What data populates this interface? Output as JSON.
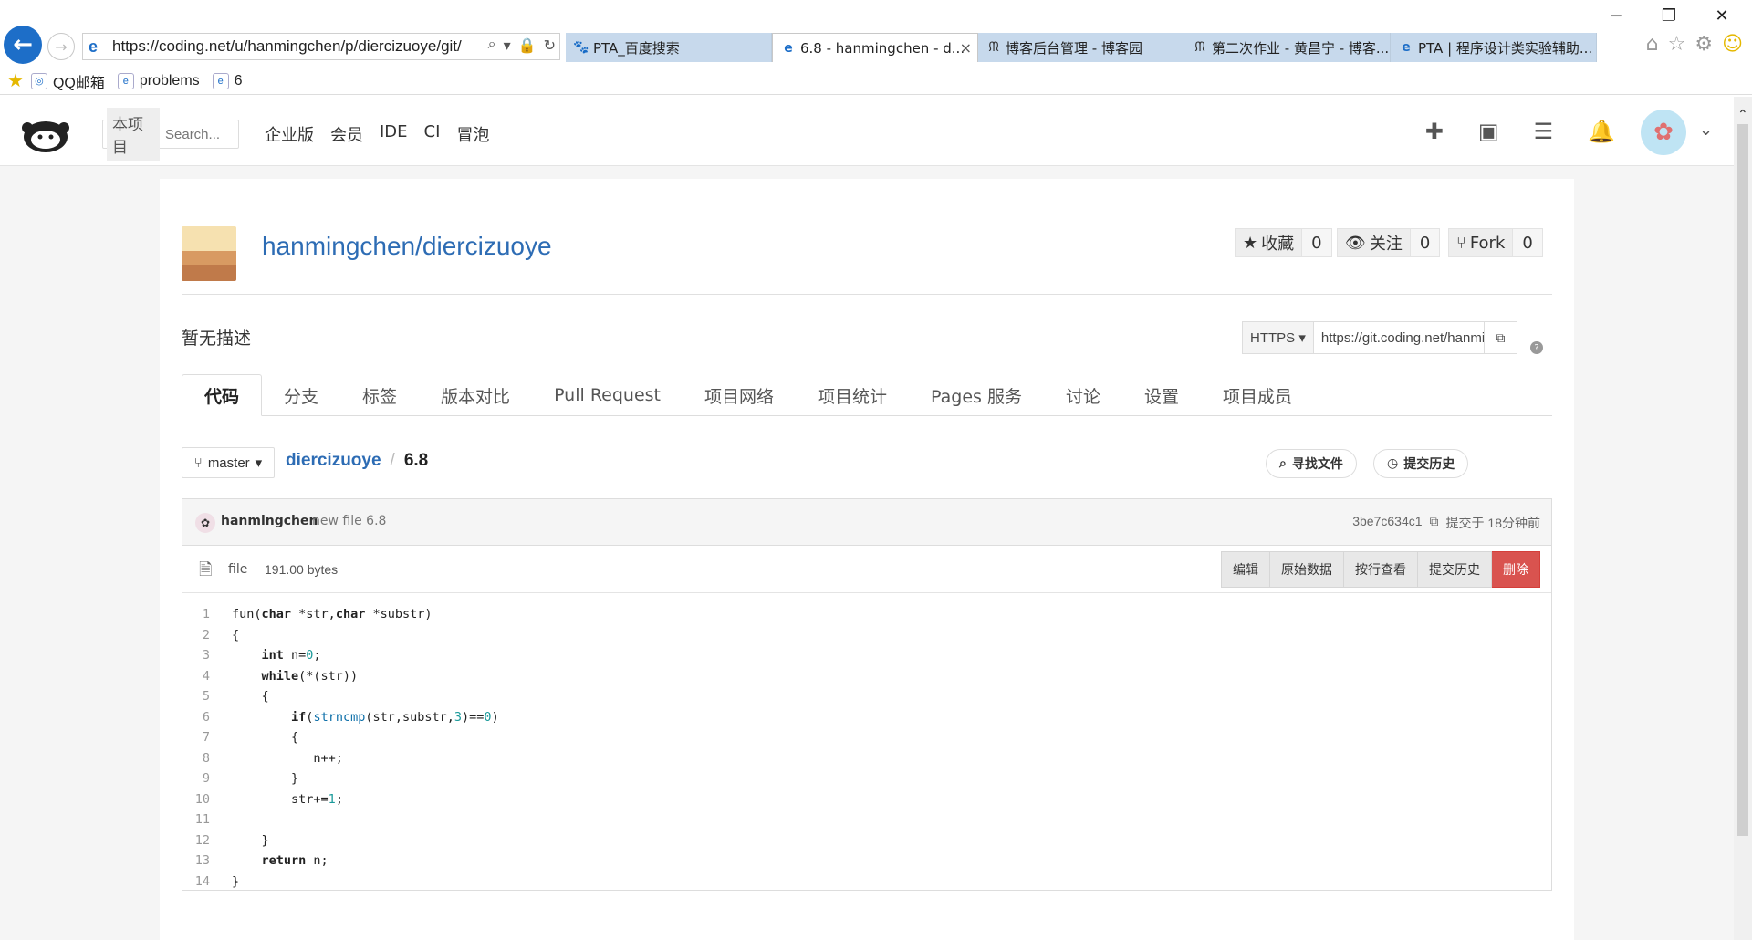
{
  "browser": {
    "address": "https://coding.net/u/hanmingchen/p/diercizuoye/git/",
    "tabs": [
      {
        "label": "PTA_百度搜索"
      },
      {
        "label": "6.8 - hanmingchen - d..."
      },
      {
        "label": "博客后台管理 - 博客园"
      },
      {
        "label": "第二次作业 - 黄昌宁 - 博客..."
      },
      {
        "label": "PTA | 程序设计类实验辅助..."
      }
    ],
    "favorites": [
      {
        "label": "QQ邮箱"
      },
      {
        "label": "problems"
      },
      {
        "label": "6"
      }
    ],
    "window_controls": {
      "minimize": "−",
      "maximize": "❐",
      "close": "✕"
    }
  },
  "header": {
    "search_scope": "本项目",
    "search_placeholder": "Search...",
    "nav": [
      "企业版",
      "会员",
      "IDE",
      "CI",
      "冒泡"
    ]
  },
  "project": {
    "title": "hanmingchen/diercizuoye",
    "description": "暂无描述",
    "stats": {
      "star_label": "收藏",
      "star_count": "0",
      "watch_label": "关注",
      "watch_count": "0",
      "fork_label": "Fork",
      "fork_count": "0"
    },
    "clone": {
      "protocol": "HTTPS",
      "url": "https://git.coding.net/hanmingchen/diercizuoye.git"
    },
    "tabs": [
      "代码",
      "分支",
      "标签",
      "版本对比",
      "Pull Request",
      "项目网络",
      "项目统计",
      "Pages 服务",
      "讨论",
      "设置",
      "项目成员"
    ]
  },
  "file_nav": {
    "branch": "master",
    "repo": "diercizuoye",
    "separator": "/",
    "file": "6.8",
    "find_file": "寻找文件",
    "history": "提交历史"
  },
  "commit": {
    "author": "hanmingchen",
    "message": "new file 6.8",
    "hash": "3be7c634c1",
    "time": "提交于 18分钟前"
  },
  "file": {
    "type": "file",
    "size": "191.00 bytes",
    "buttons": {
      "edit": "编辑",
      "raw": "原始数据",
      "blame": "按行查看",
      "history": "提交历史",
      "delete": "删除"
    },
    "lines": [
      "fun(char *str,char *substr)",
      "{",
      "    int n=0;",
      "    while(*(str))",
      "    {",
      "        if(strncmp(str,substr,3)==0)",
      "        {",
      "           n++;",
      "        }",
      "        str+=1;",
      "",
      "    }",
      "    return n;",
      "}"
    ]
  },
  "colors": {
    "link": "#2d6cb4",
    "danger": "#d9534f",
    "tab_bg": "#c7d9ec"
  }
}
